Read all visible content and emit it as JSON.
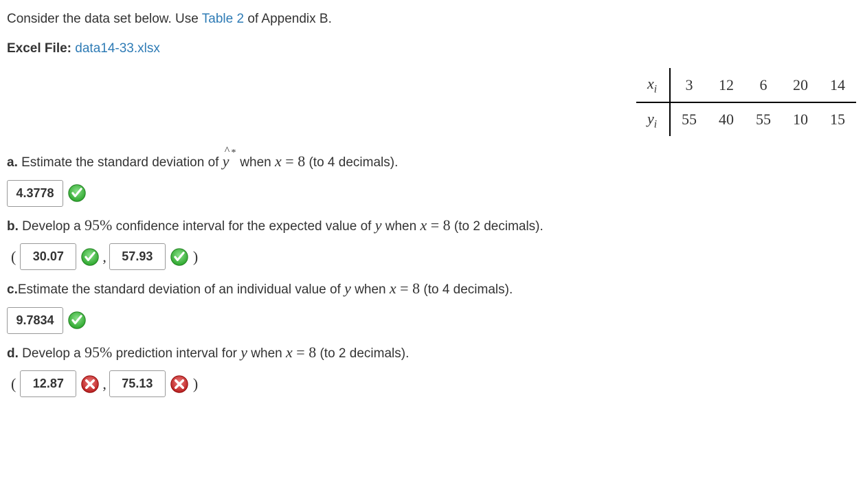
{
  "intro_prefix": "Consider the data set below. Use ",
  "table2_link": "Table 2",
  "intro_suffix": " of Appendix B.",
  "excel_label": "Excel File: ",
  "excel_file": "data14-33.xlsx",
  "data_table": {
    "row1_header": "x",
    "row1_sub": "i",
    "row2_header": "y",
    "row2_sub": "i",
    "x": [
      "3",
      "12",
      "6",
      "20",
      "14"
    ],
    "y": [
      "55",
      "40",
      "55",
      "10",
      "15"
    ]
  },
  "qa": {
    "label_a": "a.",
    "text_a_pre": " Estimate the standard deviation of ",
    "text_a_post": " when ",
    "x_equals": "x = 8",
    "paren_a": " (to 4 decimals).",
    "ans_a": "4.3778",
    "label_b": "b.",
    "text_b_pre": " Develop a ",
    "pct95": "95%",
    "text_b_mid": " confidence interval for the expected value of ",
    "y_var": "y",
    "text_b_when": " when ",
    "paren_b": " (to 2 decimals).",
    "ans_b_lo": "30.07",
    "ans_b_hi": "57.93",
    "label_c": "c.",
    "text_c": "Estimate the standard deviation of an individual value of ",
    "paren_c": " (to 4 decimals).",
    "ans_c": "9.7834",
    "label_d": "d.",
    "text_d_pre": " Develop a ",
    "text_d_mid": " prediction interval for ",
    "paren_d": " (to 2 decimals).",
    "ans_d_lo": "12.87",
    "ans_d_hi": "75.13"
  },
  "icons": {
    "check": "check-icon",
    "cross": "cross-icon"
  },
  "chart_data": {
    "type": "table",
    "rows": [
      {
        "label": "x_i",
        "values": [
          3,
          12,
          6,
          20,
          14
        ]
      },
      {
        "label": "y_i",
        "values": [
          55,
          40,
          55,
          10,
          15
        ]
      }
    ]
  }
}
